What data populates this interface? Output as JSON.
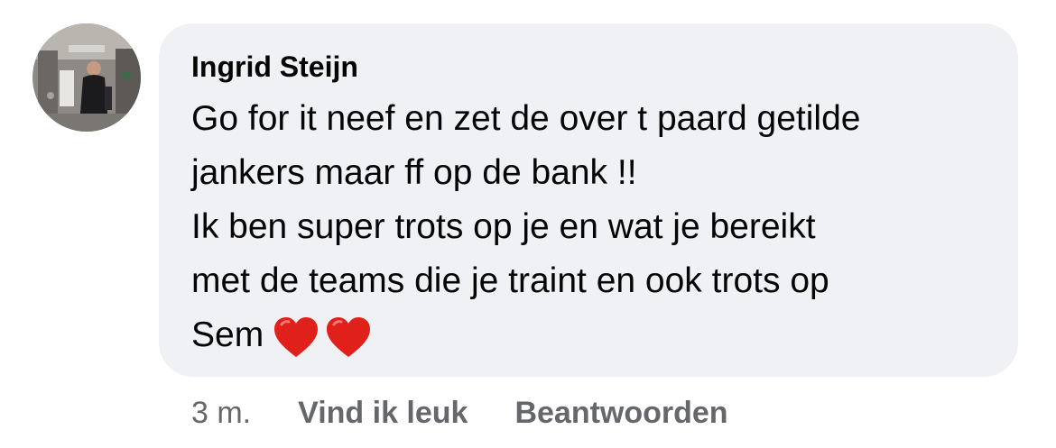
{
  "comment": {
    "author_name": "Ingrid Steijn",
    "avatar": "profile-photo",
    "text_lines": [
      "Go for it neef en zet de over t paard getilde",
      "jankers maar ff op de bank !!",
      "Ik ben super trots op je en wat je bereikt",
      "met de teams die je traint en ook trots op",
      "Sem"
    ],
    "emoji": [
      "red-heart",
      "red-heart"
    ],
    "timestamp": "3 m.",
    "like_label": "Vind ik leuk",
    "reply_label": "Beantwoorden"
  },
  "colors": {
    "bubble_bg": "#f0f1f4",
    "text": "#050505",
    "secondary_text": "#65676b",
    "heart": "#e0201b"
  }
}
